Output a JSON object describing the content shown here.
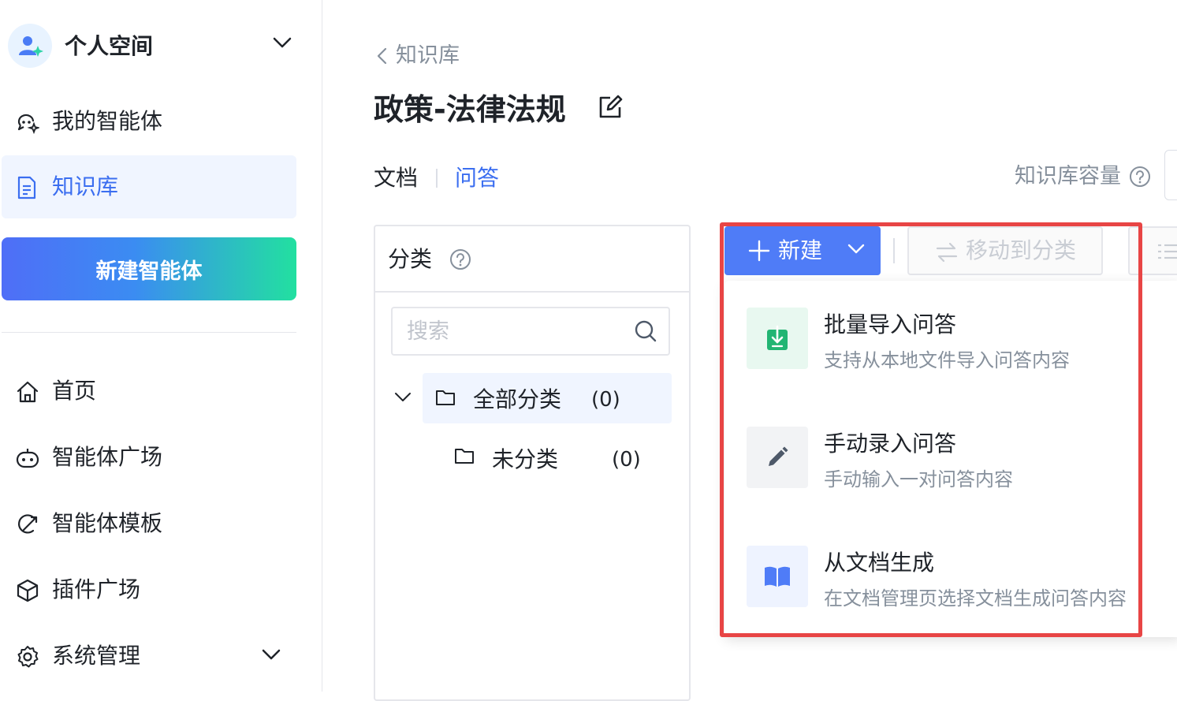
{
  "sidebar": {
    "space_name": "个人空间",
    "nav_top": [
      {
        "label": "我的智能体",
        "icon": "bot-sparkle-icon"
      },
      {
        "label": "知识库",
        "icon": "document-icon"
      }
    ],
    "new_agent_label": "新建智能体",
    "nav_bottom": [
      {
        "label": "首页",
        "icon": "home-icon"
      },
      {
        "label": "智能体广场",
        "icon": "robot-icon"
      },
      {
        "label": "智能体模板",
        "icon": "template-icon"
      },
      {
        "label": "插件广场",
        "icon": "cube-icon"
      },
      {
        "label": "系统管理",
        "icon": "gear-icon"
      }
    ],
    "active_item": "知识库"
  },
  "header": {
    "breadcrumb": "知识库",
    "title": "政策-法律法规"
  },
  "tabs": [
    {
      "label": "文档"
    },
    {
      "label": "问答"
    }
  ],
  "active_tab": "问答",
  "capacity_label": "知识库容量",
  "category": {
    "title": "分类",
    "search_placeholder": "搜索",
    "tree": [
      {
        "label": "全部分类",
        "count": "(0)"
      },
      {
        "label": "未分类",
        "count": "(0)"
      }
    ]
  },
  "toolbar": {
    "new_label": "新建",
    "move_label": "移动到分类"
  },
  "new_menu": [
    {
      "title": "批量导入问答",
      "desc": "支持从本地文件导入问答内容",
      "icon": "import-icon"
    },
    {
      "title": "手动录入问答",
      "desc": "手动输入一对问答内容",
      "icon": "pencil-icon"
    },
    {
      "title": "从文档生成",
      "desc": "在文档管理页选择文档生成问答内容",
      "icon": "book-icon"
    }
  ],
  "colors": {
    "primary": "#4f7cf7",
    "active_text": "#3b6ef0",
    "highlight_border": "#e84545",
    "gradient_end": "#22e0a0"
  }
}
